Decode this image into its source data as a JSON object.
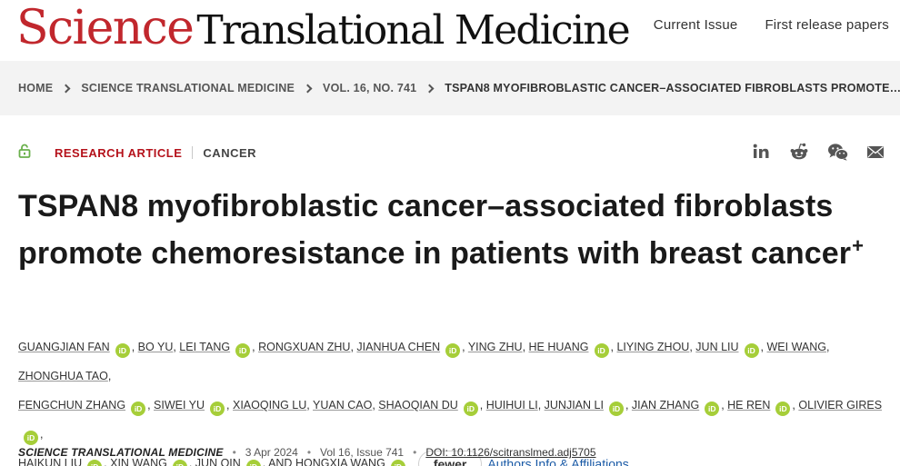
{
  "header": {
    "logo_science": "Science",
    "logo_rest": "Translational Medicine",
    "nav": [
      "Current Issue",
      "First release papers"
    ]
  },
  "breadcrumb": [
    "HOME",
    "SCIENCE TRANSLATIONAL MEDICINE",
    "VOL. 16, NO. 741",
    "TSPAN8 MYOFIBROBLASTIC CANCER–ASSOCIATED FIBROBLASTS PROMOTE…"
  ],
  "article": {
    "type": "RESEARCH ARTICLE",
    "subject": "CANCER",
    "title": "TSPAN8 myofibroblastic cancer–associated fibroblasts promote chemoresistance in patients with breast cancer",
    "title_mark": "+",
    "authors": [
      "Guangjian Fan",
      "Bo Yu",
      "Lei Tang",
      "Rongxuan Zhu",
      "Jianhua Chen",
      "Ying Zhu",
      "He Huang",
      "Liying Zhou",
      "Jun Liu",
      "Wei Wang",
      "Zhonghua Tao",
      "Fengchun Zhang",
      "Siwei Yu",
      "Xiaoqing Lu",
      "Yuan Cao",
      "Shaoqian Du",
      "Huihui Li",
      "Junjian Li",
      "Jian Zhang",
      "He Ren",
      "Olivier Gires",
      "Haikun Liu",
      "Xin Wang",
      "Jun Qin",
      "Hongxia Wang"
    ],
    "orcid_label": "iD",
    "and_label": "AND",
    "fewer_label": "fewer",
    "affiliations_label": "Authors Info & Affiliations"
  },
  "publication": {
    "journal": "SCIENCE TRANSLATIONAL MEDICINE",
    "date": "3 Apr 2024",
    "volume_issue": "Vol 16, Issue 741",
    "doi": "DOI: 10.1126/scitranslmed.adj5705"
  },
  "share_icons": [
    "linkedin-icon",
    "reddit-icon",
    "wechat-icon",
    "email-icon"
  ],
  "colors": {
    "brand_red": "#c1272d",
    "article_type": "#b5121b",
    "orcid_green": "#a6ce39",
    "link_blue": "#1a5aa6",
    "crumb_bg": "#f3f3f3"
  }
}
